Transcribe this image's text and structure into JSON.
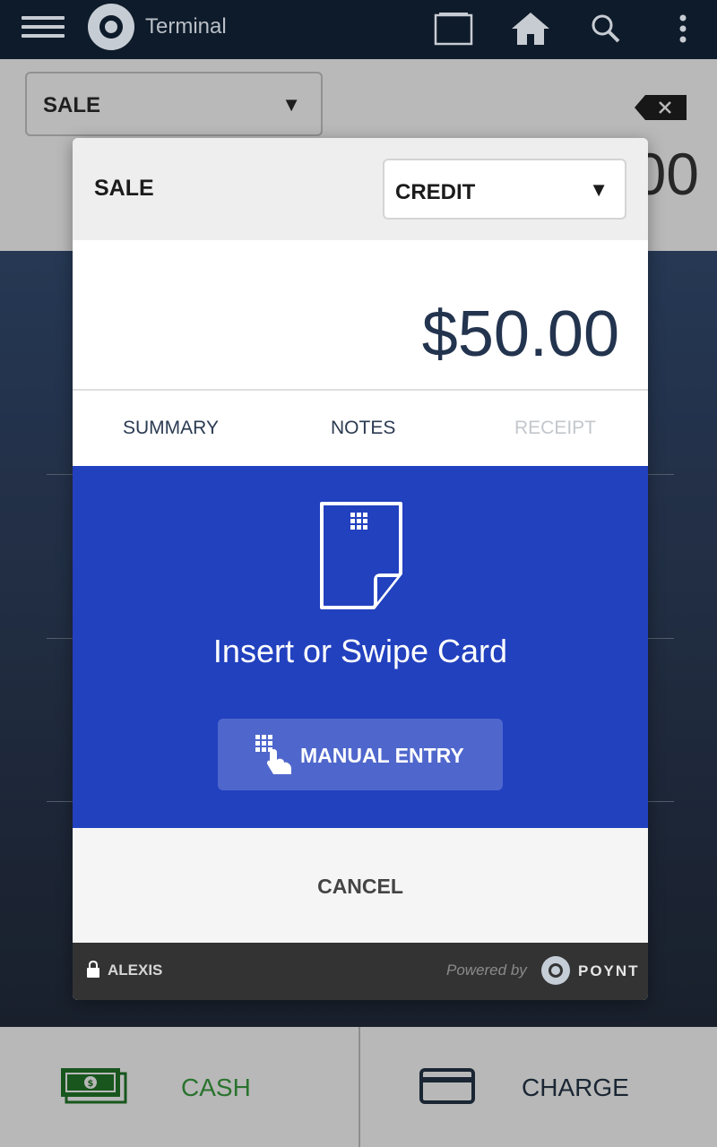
{
  "topbar": {
    "title": "Terminal",
    "icons": [
      "menu-icon",
      "app-logo",
      "window-icon",
      "home-icon",
      "search-icon",
      "more-vert-icon"
    ]
  },
  "background": {
    "sale_select": "SALE",
    "amount_partial": "00"
  },
  "modal": {
    "title": "SALE",
    "payment_type": "CREDIT",
    "amount": "$50.00",
    "tabs": [
      {
        "label": "SUMMARY",
        "enabled": true
      },
      {
        "label": "NOTES",
        "enabled": true
      },
      {
        "label": "RECEIPT",
        "enabled": false
      }
    ],
    "instruction": "Insert or Swipe Card",
    "manual_entry_label": "MANUAL ENTRY",
    "cancel_label": "CANCEL",
    "footer": {
      "user": "ALEXIS",
      "powered_by": "Powered by",
      "brand": "POYNT"
    }
  },
  "bottom": {
    "cash_label": "CASH",
    "charge_label": "CHARGE"
  },
  "colors": {
    "topbar": "#0e1b2a",
    "card_area": "#2241bf",
    "manual_button": "#4f67cc",
    "cash_green": "#2e7d32",
    "amount_text": "#23344f"
  }
}
